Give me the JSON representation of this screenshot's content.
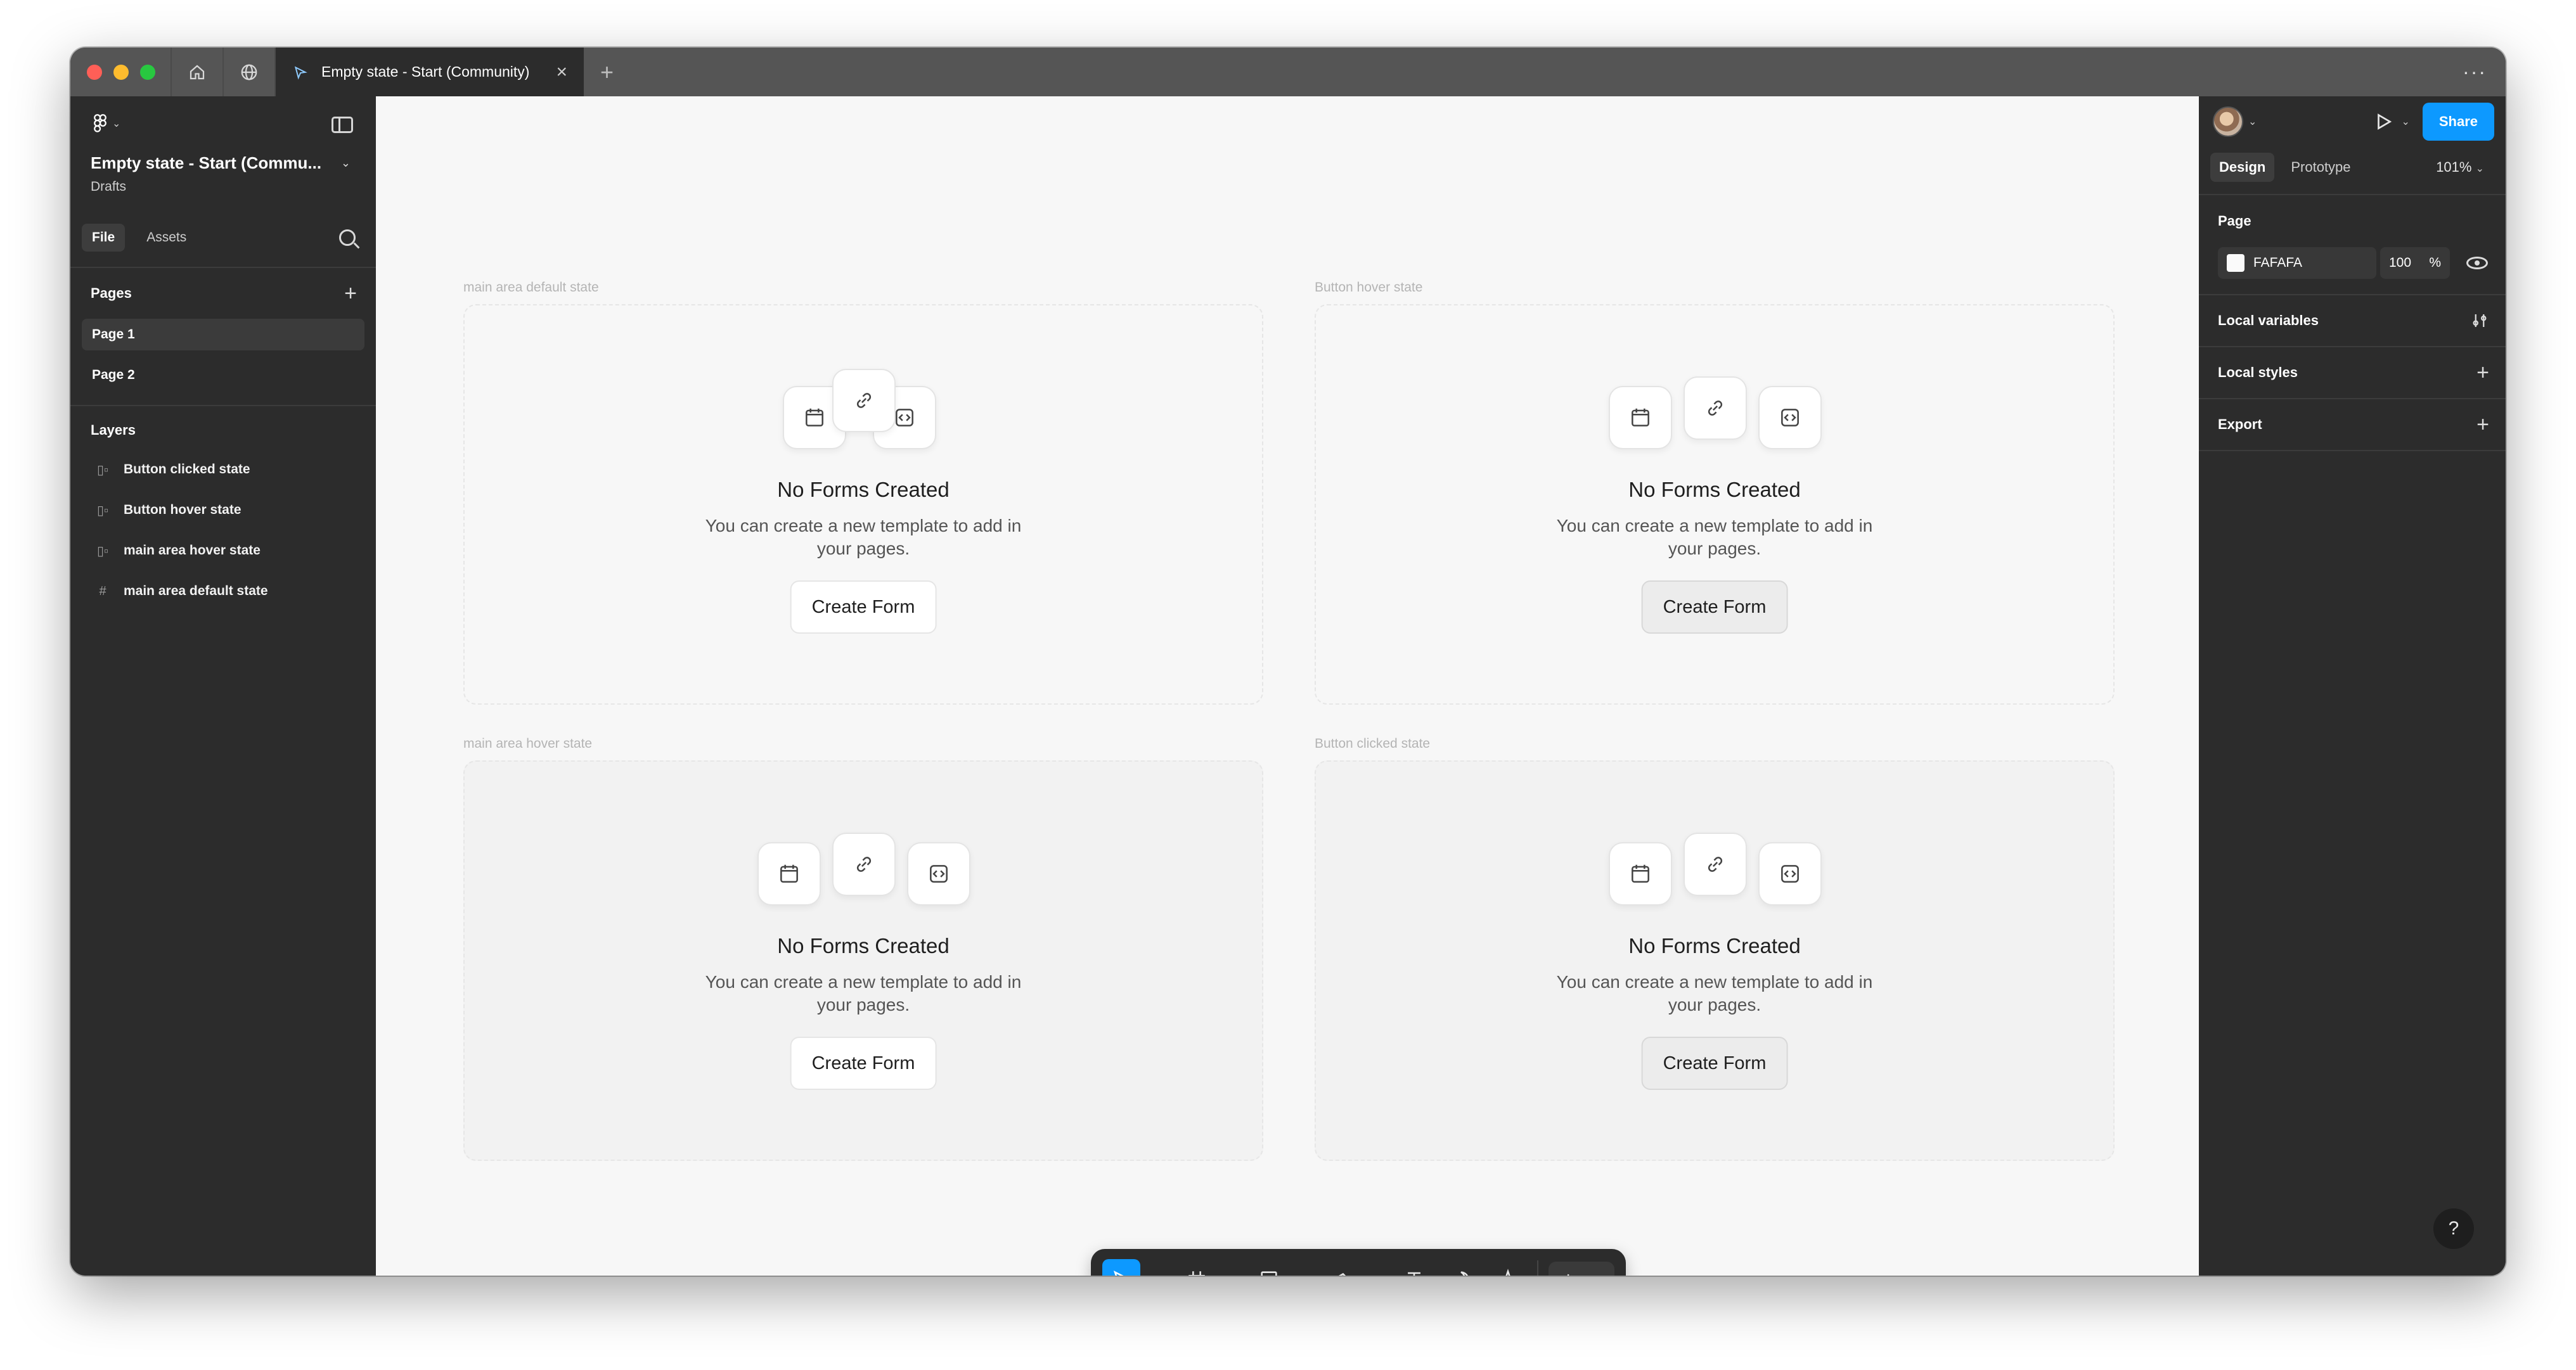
{
  "tabbar": {
    "tab_title": "Empty state - Start (Community)"
  },
  "left_panel": {
    "file_name": "Empty state - Start (Commu...",
    "location": "Drafts",
    "tabs": [
      "File",
      "Assets"
    ],
    "pages_heading": "Pages",
    "pages": [
      "Page 1",
      "Page 2"
    ],
    "layers_heading": "Layers",
    "layers": [
      {
        "name": "Button clicked state",
        "icon": "frame-vertical-icon"
      },
      {
        "name": "Button hover state",
        "icon": "frame-vertical-icon"
      },
      {
        "name": "main area hover state",
        "icon": "frame-vertical-icon"
      },
      {
        "name": "main area default state",
        "icon": "frame-hash-icon"
      }
    ]
  },
  "canvas": {
    "background": "#F7F7F7",
    "frames": [
      {
        "label": "main area default state",
        "title": "No Forms Created",
        "description": "You can create a new template to add in your pages.",
        "button": "Create Form"
      },
      {
        "label": "Button hover state",
        "title": "No Forms Created",
        "description": "You can create a new template to add in your pages.",
        "button": "Create Form"
      },
      {
        "label": "main area hover state",
        "title": "No Forms Created",
        "description": "You can create a new template to add in your pages.",
        "button": "Create Form"
      },
      {
        "label": "Button clicked state",
        "title": "No Forms Created",
        "description": "You can create a new template to add in your pages.",
        "button": "Create Form"
      }
    ]
  },
  "toolbar": {
    "tools": [
      "move-icon",
      "frame-icon",
      "rectangle-icon",
      "pen-icon",
      "text-icon",
      "comment-icon",
      "actions-icon",
      "dev-mode-icon"
    ]
  },
  "right_panel": {
    "share_label": "Share",
    "tabs": [
      "Design",
      "Prototype"
    ],
    "zoom": "101%",
    "page_heading": "Page",
    "page_color": "FAFAFA",
    "page_opacity": "100",
    "percent_sign": "%",
    "sections": [
      "Local variables",
      "Local styles",
      "Export"
    ]
  },
  "help_label": "?",
  "colors": {
    "accent": "#0D99FF",
    "panel": "#2C2C2C",
    "titlebar": "#555555"
  }
}
